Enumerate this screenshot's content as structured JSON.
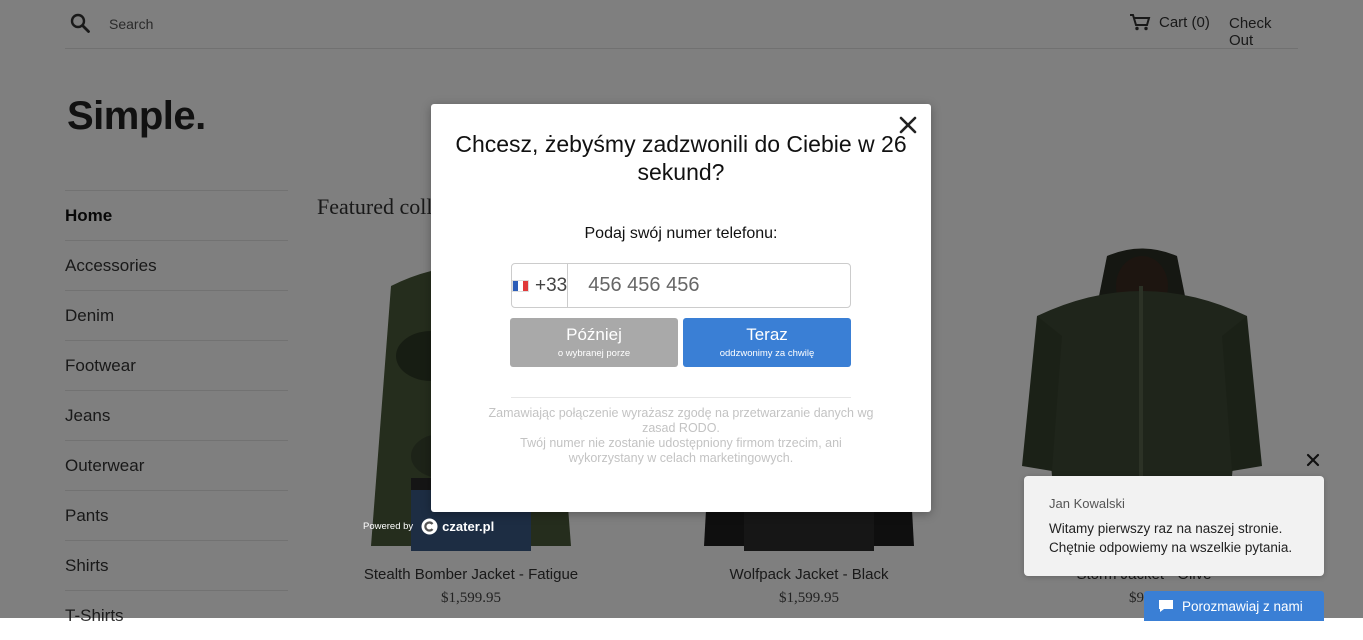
{
  "store": {
    "search_placeholder": "Search",
    "cart_label": "Cart (0)",
    "checkout_label": "Check Out",
    "logo": "Simple.",
    "nav": [
      "Home",
      "Accessories",
      "Denim",
      "Footwear",
      "Jeans",
      "Outerwear",
      "Pants",
      "Shirts",
      "T-Shirts"
    ],
    "featured_heading": "Featured collection",
    "products": [
      {
        "title": "Stealth Bomber Jacket - Fatigue",
        "price": "$1,599.95"
      },
      {
        "title": "Wolfpack Jacket - Black",
        "price": "$1,599.95"
      },
      {
        "title": "Storm Jacket - Olive",
        "price": "$999"
      }
    ]
  },
  "modal": {
    "title": "Chcesz, żebyśmy zadzwonili do Ciebie w 26 sekund?",
    "subtitle": "Podaj swój numer telefonu:",
    "country_code": "+33",
    "phone_placeholder": "456 456 456",
    "later_label": "Później",
    "later_sub": "o wybranej porze",
    "now_label": "Teraz",
    "now_sub": "oddzwonimy za chwilę",
    "consent_line1": "Zamawiając połączenie wyrażasz zgodę na przetwarzanie danych wg zasad RODO.",
    "consent_line2": "Twój numer nie zostanie udostępniony firmom trzecim, ani wykorzystany w celach marketingowych.",
    "powered_by": "Powered by",
    "brand": "czater.pl"
  },
  "chat": {
    "agent_name": "Jan Kowalski",
    "message": "Witamy pierwszy raz na naszej stronie. Chętnie odpowiemy na wszelkie pytania.",
    "launcher_label": "Porozmawiaj z nami"
  },
  "colors": {
    "primary_blue": "#3a7fd5",
    "later_gray": "#a9a9a9",
    "overlay": "rgba(0,0,0,0.5)"
  }
}
